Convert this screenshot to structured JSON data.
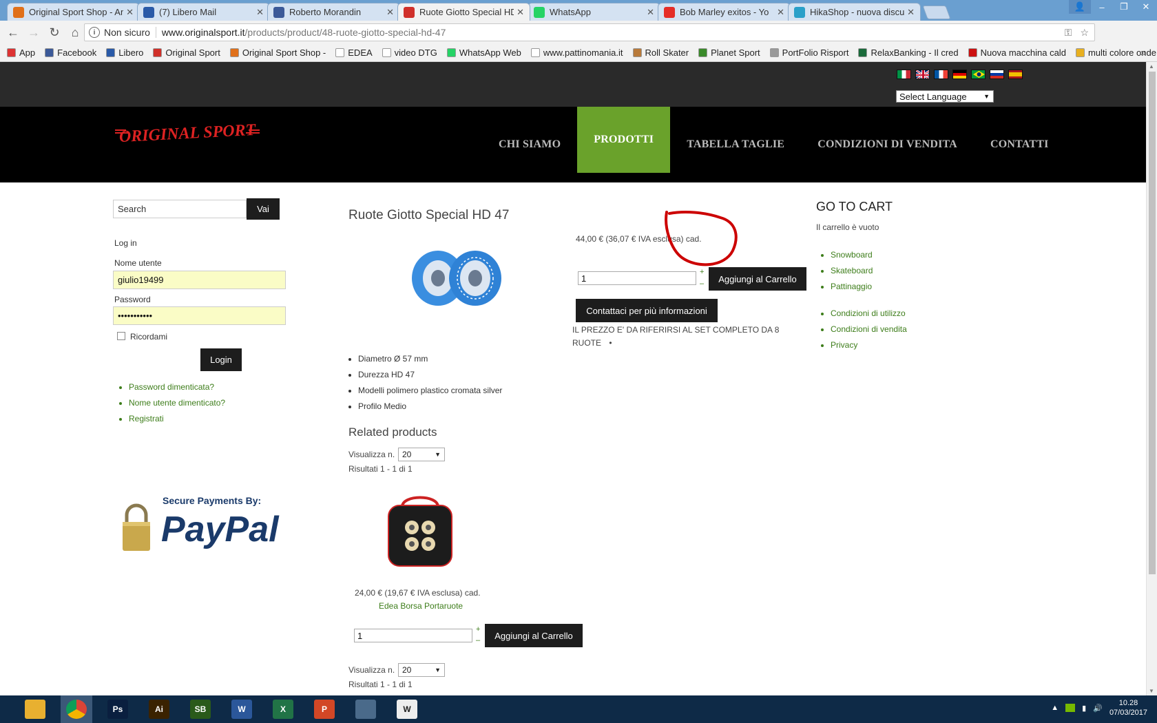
{
  "browser": {
    "tabs": [
      {
        "title": "Original Sport Shop - Am",
        "icon_color": "#e0701a",
        "icon": "joomla-icon"
      },
      {
        "title": "(7) Libero Mail",
        "icon_color": "#2a5aa8",
        "icon": "libero-icon"
      },
      {
        "title": "Roberto Morandin",
        "icon_color": "#3b5998",
        "icon": "facebook-icon"
      },
      {
        "title": "Ruote Giotto Special HD",
        "icon_color": "#d0302a",
        "icon": "original-sport-icon"
      },
      {
        "title": "WhatsApp",
        "icon_color": "#25d366",
        "icon": "whatsapp-icon"
      },
      {
        "title": "Bob Marley exitos - Yo",
        "icon_color": "#e52d27",
        "icon": "youtube-icon"
      },
      {
        "title": "HikaShop - nuova discus",
        "icon_color": "#2aa0c9",
        "icon": "hikashop-icon"
      }
    ],
    "active_tab": 3,
    "address": {
      "security_label": "Non sicuro",
      "host": "www.originalsport.it",
      "path": "/products/product/48-ruote-giotto-special-hd-47"
    },
    "bookmarks": [
      {
        "label": "App",
        "color": "#d33"
      },
      {
        "label": "Facebook",
        "color": "#3b5998"
      },
      {
        "label": "Libero",
        "color": "#2a5aa8"
      },
      {
        "label": "Original Sport",
        "color": "#d0302a"
      },
      {
        "label": "Original Sport Shop -",
        "color": "#e0701a"
      },
      {
        "label": "EDEA",
        "color": "#ffffff"
      },
      {
        "label": "video DTG",
        "color": "#ffffff"
      },
      {
        "label": "WhatsApp Web",
        "color": "#25d366"
      },
      {
        "label": "www.pattinomania.it",
        "color": "#ffffff"
      },
      {
        "label": "Roll Skater",
        "color": "#b87a3a"
      },
      {
        "label": "Planet Sport",
        "color": "#3a8a2a"
      },
      {
        "label": "PortFolio Risport",
        "color": "#999999"
      },
      {
        "label": "RelaxBanking - Il cred",
        "color": "#1a6a3a"
      },
      {
        "label": "Nuova macchina cald",
        "color": "#cc1111"
      },
      {
        "label": "multi colore onde ad",
        "color": "#e8b020"
      }
    ],
    "bookmarks_more": "»"
  },
  "site": {
    "language_select": "Select Language",
    "flags": [
      "Italiano",
      "English",
      "Français",
      "Deutsch",
      "Português",
      "Русский",
      "Español"
    ],
    "logo_text": "ORIGINAL SPORT",
    "nav": [
      {
        "label": "CHI SIAMO",
        "active": false
      },
      {
        "label": "PRODOTTI",
        "active": true
      },
      {
        "label": "TABELLA TAGLIE",
        "active": false
      },
      {
        "label": "CONDIZIONI DI VENDITA",
        "active": false
      },
      {
        "label": "CONTATTI",
        "active": false
      }
    ],
    "accent_color": "#6aa22b"
  },
  "sidebar": {
    "search_placeholder": "Search",
    "search_button": "Vai",
    "login_heading": "Log in",
    "username_label": "Nome utente",
    "username_value": "giulio19499",
    "password_label": "Password",
    "password_value": "•••••••••••",
    "remember_label": "Ricordami",
    "login_button": "Login",
    "links": [
      "Password dimenticata?",
      "Nome utente dimenticato?",
      "Registrati"
    ],
    "paypal_caption": "Secure Payments By:",
    "paypal_brand": "PayPal"
  },
  "product": {
    "title": "Ruote Giotto Special HD 47",
    "price": "44,00 € (36,07 € IVA esclusa) cad.",
    "quantity": "1",
    "add_to_cart": "Aggiungi al Carrello",
    "contact_button": "Contattaci per più informazioni",
    "note": "IL PREZZO E' DA RIFERIRSI AL SET COMPLETO DA 8 RUOTE",
    "features": [
      "Diametro Ø 57 mm",
      "Durezza HD 47",
      "Modelli polimero plastico cromata silver",
      "Profilo Medio"
    ]
  },
  "related": {
    "heading": "Related products",
    "show_label": "Visualizza n.",
    "show_value": "20",
    "results": "Risultati 1 - 1 di 1",
    "item": {
      "price": "24,00 € (19,67 € IVA esclusa) cad.",
      "name": "Edea Borsa Portaruote",
      "quantity": "1",
      "add_to_cart": "Aggiungi al Carrello"
    }
  },
  "cart": {
    "title": "GO TO CART",
    "empty": "Il carrello è vuoto",
    "categories": [
      "Snowboard",
      "Skateboard",
      "Pattinaggio"
    ],
    "info_links": [
      "Condizioni di utilizzo",
      "Condizioni di vendita",
      "Privacy"
    ]
  },
  "taskbar": {
    "apps": [
      {
        "name": "file-explorer",
        "label": "",
        "color": "#e8b030"
      },
      {
        "name": "chrome",
        "label": "",
        "color": "#3a78c8"
      },
      {
        "name": "photoshop",
        "label": "Ps",
        "color": "#0a1f3f"
      },
      {
        "name": "illustrator",
        "label": "Ai",
        "color": "#3a2200"
      },
      {
        "name": "sb",
        "label": "SB",
        "color": "#2a5a1a"
      },
      {
        "name": "word",
        "label": "W",
        "color": "#2b579a"
      },
      {
        "name": "excel",
        "label": "X",
        "color": "#217346"
      },
      {
        "name": "powerpoint",
        "label": "P",
        "color": "#d24726"
      },
      {
        "name": "backup",
        "label": "",
        "color": "#4a6a8a"
      },
      {
        "name": "w-app",
        "label": "W",
        "color": "#eeeeee"
      }
    ],
    "time": "10.28",
    "date": "07/03/2017"
  }
}
